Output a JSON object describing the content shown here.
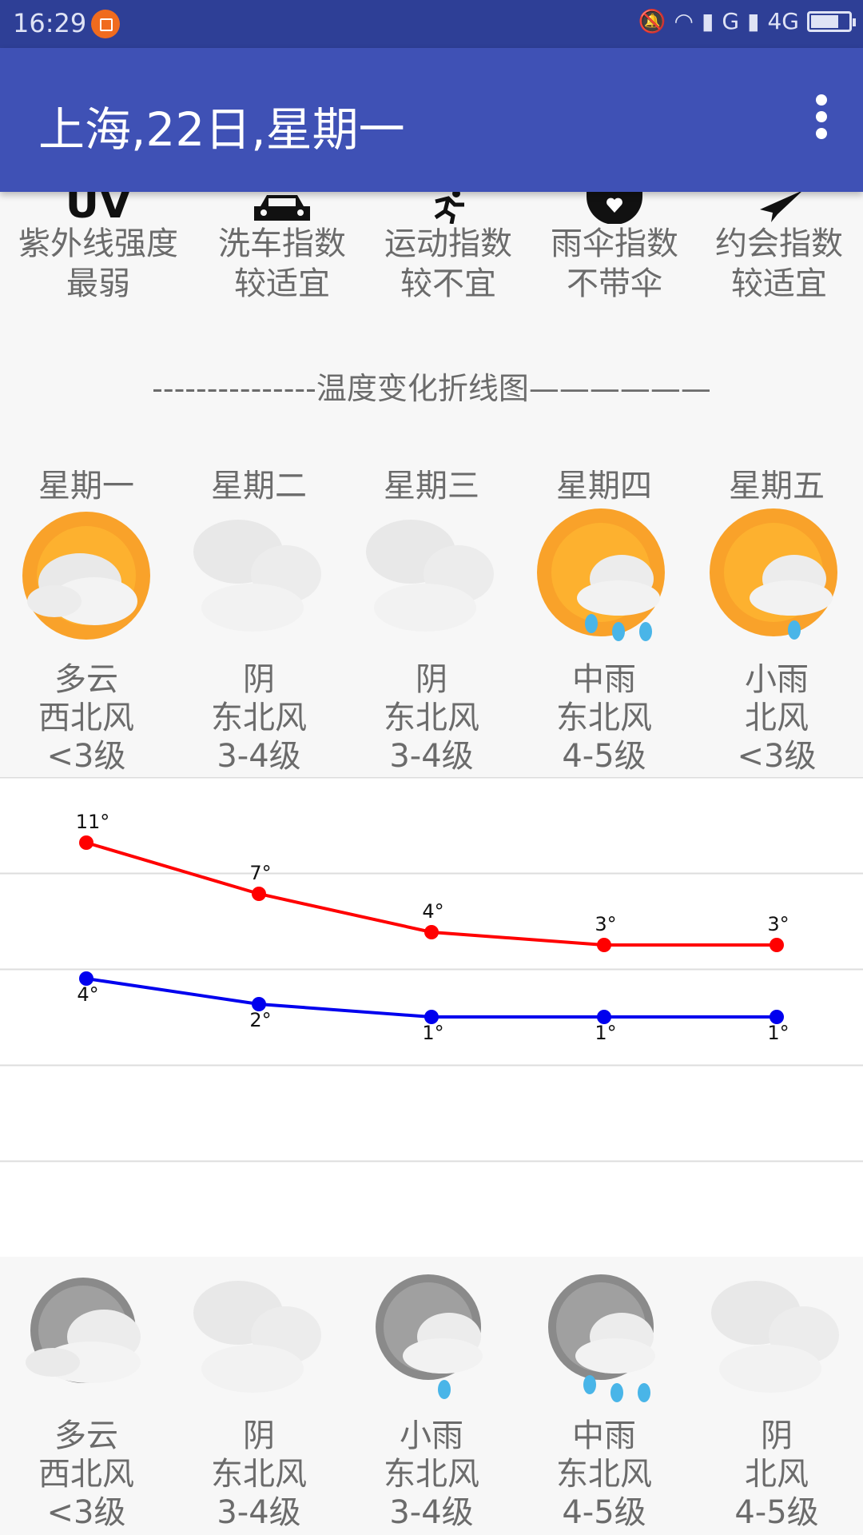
{
  "status_bar": {
    "time": "16:29",
    "network_1": "G",
    "network_2": "4G"
  },
  "app_bar": {
    "title": "上海,22日,星期一"
  },
  "life_indices": [
    {
      "icon": "uv-icon",
      "icon_text": "UV",
      "name": "紫外线强度",
      "value": "最弱"
    },
    {
      "icon": "car-icon",
      "icon_text": "",
      "name": "洗车指数",
      "value": "较适宜"
    },
    {
      "icon": "running-icon",
      "icon_text": "",
      "name": "运动指数",
      "value": "较不宜"
    },
    {
      "icon": "umbrella-heart-icon",
      "icon_text": "",
      "name": "雨伞指数",
      "value": "不带伞"
    },
    {
      "icon": "paper-plane-icon",
      "icon_text": "",
      "name": "约会指数",
      "value": "较适宜"
    }
  ],
  "chart_title": "---------------温度变化折线图——————",
  "days": [
    "星期一",
    "星期二",
    "星期三",
    "星期四",
    "星期五"
  ],
  "day_weather": [
    {
      "icon": "partly-cloudy-day-icon",
      "cond": "多云",
      "wind": "西北风",
      "level": "<3级"
    },
    {
      "icon": "overcast-icon",
      "cond": "阴",
      "wind": "东北风",
      "level": "3-4级"
    },
    {
      "icon": "overcast-icon",
      "cond": "阴",
      "wind": "东北风",
      "level": "3-4级"
    },
    {
      "icon": "sun-moderate-rain-icon",
      "cond": "中雨",
      "wind": "东北风",
      "level": "4-5级"
    },
    {
      "icon": "sun-light-rain-icon",
      "cond": "小雨",
      "wind": "北风",
      "level": "<3级"
    }
  ],
  "night_weather": [
    {
      "icon": "partly-cloudy-night-icon",
      "cond": "多云",
      "wind": "西北风",
      "level": "<3级"
    },
    {
      "icon": "overcast-icon",
      "cond": "阴",
      "wind": "东北风",
      "level": "3-4级"
    },
    {
      "icon": "moon-light-rain-icon",
      "cond": "小雨",
      "wind": "东北风",
      "level": "3-4级"
    },
    {
      "icon": "moon-moderate-rain-icon",
      "cond": "中雨",
      "wind": "东北风",
      "level": "4-5级"
    },
    {
      "icon": "overcast-icon",
      "cond": "阴",
      "wind": "北风",
      "level": "4-5级"
    }
  ],
  "chart_data": {
    "type": "line",
    "categories": [
      "星期一",
      "星期二",
      "星期三",
      "星期四",
      "星期五"
    ],
    "series": [
      {
        "values": [
          11,
          7,
          4,
          3,
          3
        ],
        "color": "#ff0000",
        "labels": [
          "11°",
          "7°",
          "4°",
          "3°",
          "3°"
        ]
      },
      {
        "values": [
          4,
          2,
          1,
          1,
          1
        ],
        "color": "#0000ee",
        "labels": [
          "4°",
          "2°",
          "1°",
          "1°",
          "1°"
        ]
      }
    ],
    "grid": true
  }
}
